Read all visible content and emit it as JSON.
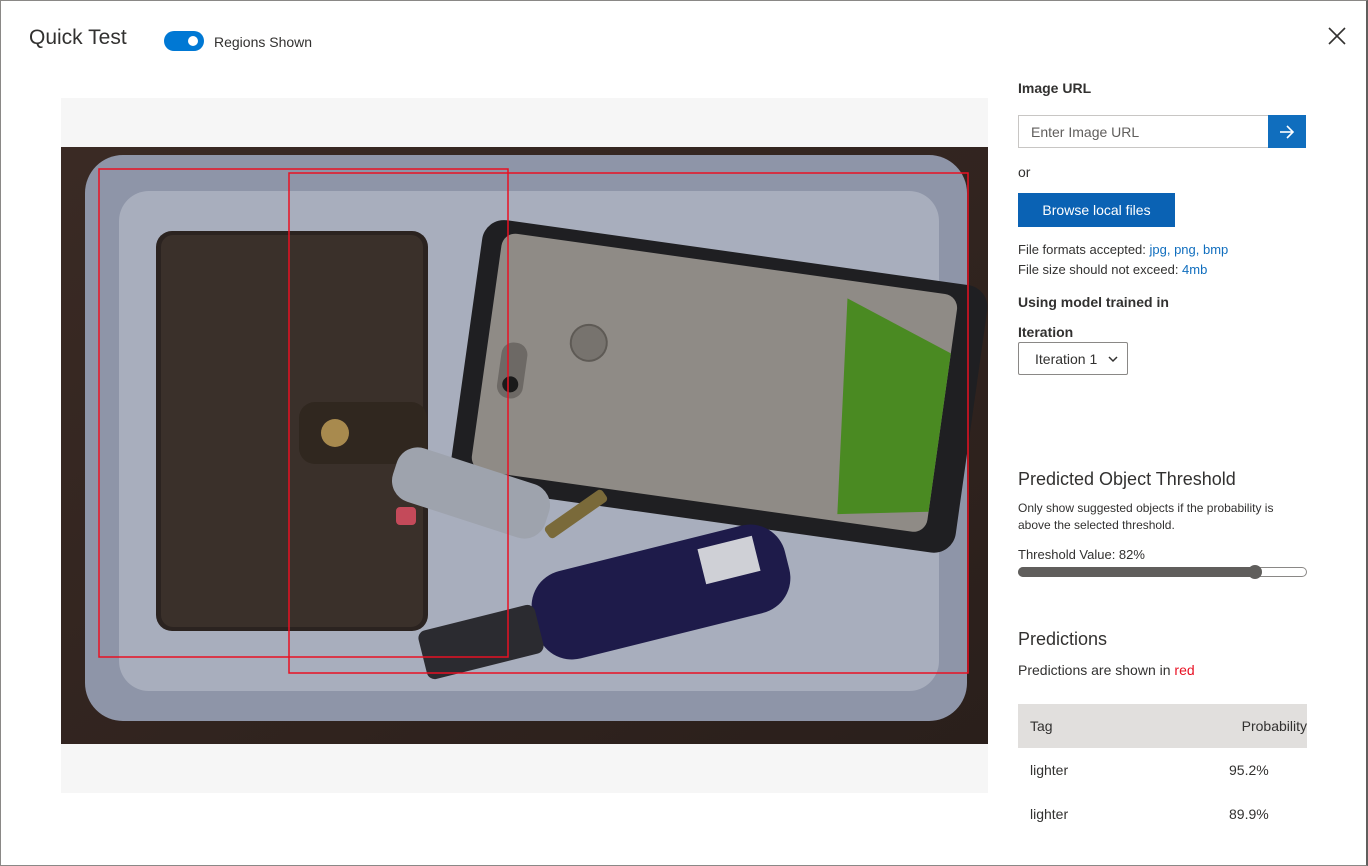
{
  "header": {
    "title": "Quick Test",
    "toggle_label": "Regions Shown",
    "toggle_on": true
  },
  "image_url": {
    "label": "Image URL",
    "placeholder": "Enter Image URL",
    "or_text": "or",
    "browse_label": "Browse local files",
    "formats_prefix": "File formats accepted: ",
    "formats_value": "jpg, png, bmp",
    "size_prefix": "File size should not exceed: ",
    "size_value": "4mb"
  },
  "model": {
    "label": "Using model trained in",
    "iteration_label": "Iteration",
    "iteration_selected": "Iteration 1"
  },
  "threshold": {
    "title": "Predicted Object Threshold",
    "description": "Only show suggested objects if the probability is above the selected threshold.",
    "value_text": "Threshold Value: 82%",
    "value_fraction": 0.82
  },
  "predictions": {
    "title": "Predictions",
    "shown_prefix": "Predictions are shown in ",
    "shown_color_word": "red",
    "columns": [
      "Tag",
      "Probability"
    ],
    "rows": [
      {
        "tag": "lighter",
        "probability": "95.2%"
      },
      {
        "tag": "lighter",
        "probability": "89.9%"
      }
    ]
  },
  "colors": {
    "accent": "#0078d4",
    "prediction_box": "#e81123"
  },
  "icons": {
    "close": "close-icon",
    "go": "arrow-right-icon",
    "dropdown": "chevron-down-icon"
  }
}
